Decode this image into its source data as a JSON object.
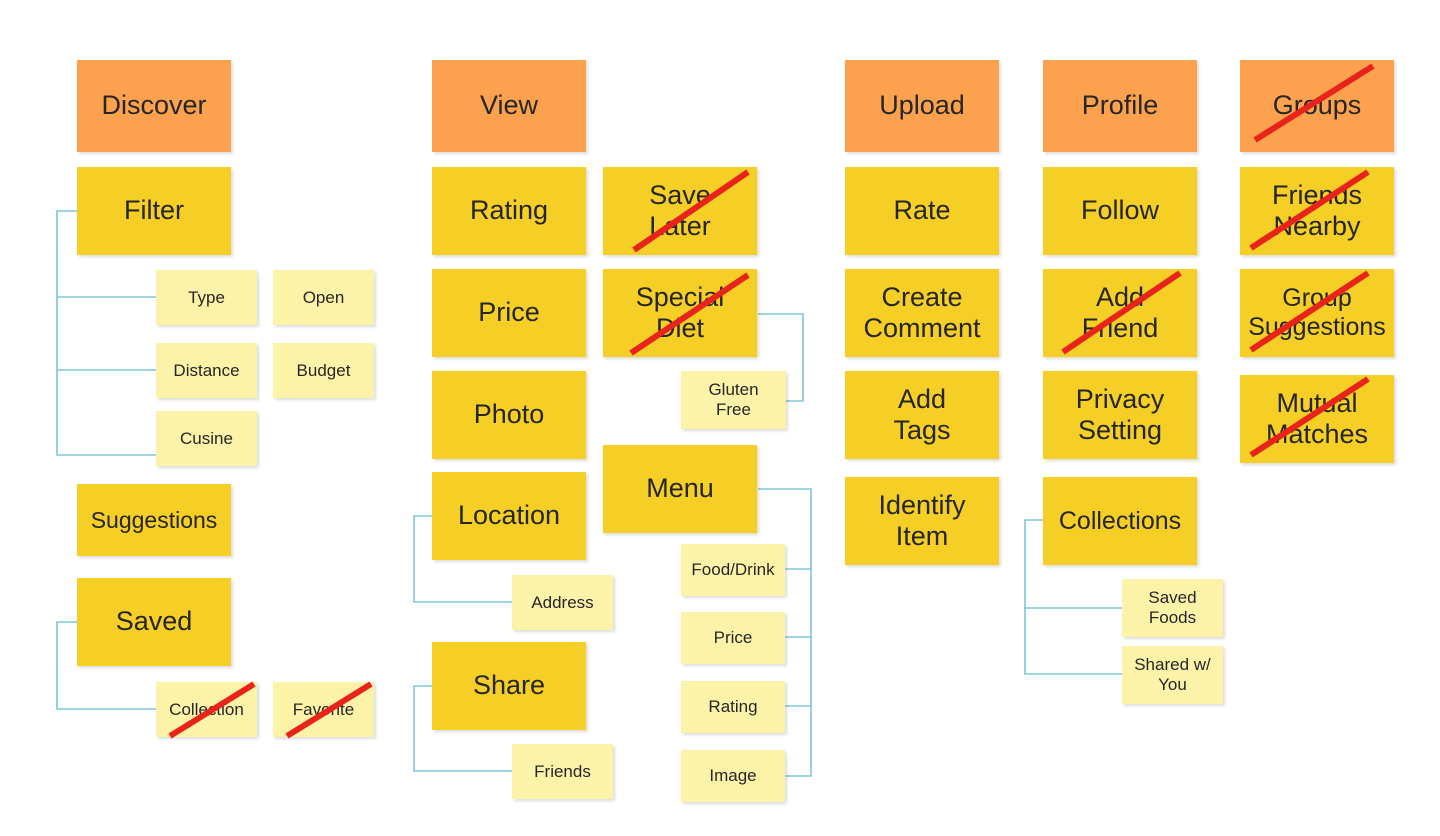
{
  "diagram": {
    "title": "App Feature Sitemap",
    "colors": {
      "background": "#FFFFFF",
      "level0": "#FCA14D",
      "level1": "#F5CE26",
      "level2": "#FCF3A8",
      "connector": "#7FC5DC",
      "strikethrough": "#E8231A",
      "text": "#262626"
    },
    "columns": [
      {
        "name": "discover",
        "header": "Discover",
        "items": [
          "Filter",
          "Type",
          "Open",
          "Distance",
          "Budget",
          "Cusine",
          "Suggestions",
          "Saved",
          "Collection",
          "Favorite"
        ]
      },
      {
        "name": "view",
        "header": "View",
        "items": [
          "Rating",
          "Save Later",
          "Price",
          "Special Diet",
          "Photo",
          "Gluten Free",
          "Location",
          "Menu",
          "Address",
          "Food/Drink",
          "Share",
          "Price",
          "Rating",
          "Friends",
          "Image"
        ]
      },
      {
        "name": "upload",
        "header": "Upload",
        "items": [
          "Rate",
          "Create Comment",
          "Add Tags",
          "Identify Item"
        ]
      },
      {
        "name": "profile",
        "header": "Profile",
        "items": [
          "Follow",
          "Add Friend",
          "Privacy Setting",
          "Collections",
          "Saved Foods",
          "Shared w/ You"
        ]
      },
      {
        "name": "groups",
        "header": "Groups",
        "items": [
          "Friends Nearby",
          "Group Suggestions",
          "Mutual Matches"
        ]
      }
    ]
  },
  "nodes": {
    "discover": "Discover",
    "filter": "Filter",
    "type": "Type",
    "open": "Open",
    "distance": "Distance",
    "budget": "Budget",
    "cusine": "Cusine",
    "suggestions": "Suggestions",
    "saved": "Saved",
    "collection": "Collection",
    "favorite": "Favorite",
    "view": "View",
    "rating": "Rating",
    "save_later": "Save\nLater",
    "price": "Price",
    "special_diet": "Special\nDiet",
    "photo": "Photo",
    "gluten_free": "Gluten\nFree",
    "location": "Location",
    "menu": "Menu",
    "address": "Address",
    "menu_food_drink": "Food/Drink",
    "share": "Share",
    "menu_price": "Price",
    "menu_rating": "Rating",
    "friends": "Friends",
    "menu_image": "Image",
    "upload": "Upload",
    "rate": "Rate",
    "create_comment": "Create\nComment",
    "add_tags": "Add\nTags",
    "identify_item": "Identify\nItem",
    "profile": "Profile",
    "follow": "Follow",
    "add_friend": "Add\nFriend",
    "privacy_setting": "Privacy\nSetting",
    "collections": "Collections",
    "saved_foods": "Saved\nFoods",
    "shared_w_you": "Shared w/\nYou",
    "groups": "Groups",
    "friends_nearby": "Friends\nNearby",
    "group_suggestions": "Group\nSuggestions",
    "mutual_matches": "Mutual\nMatches"
  },
  "struck_out": [
    "collection",
    "favorite",
    "save_later",
    "special_diet",
    "add_friend",
    "groups",
    "friends_nearby",
    "group_suggestions",
    "mutual_matches"
  ]
}
